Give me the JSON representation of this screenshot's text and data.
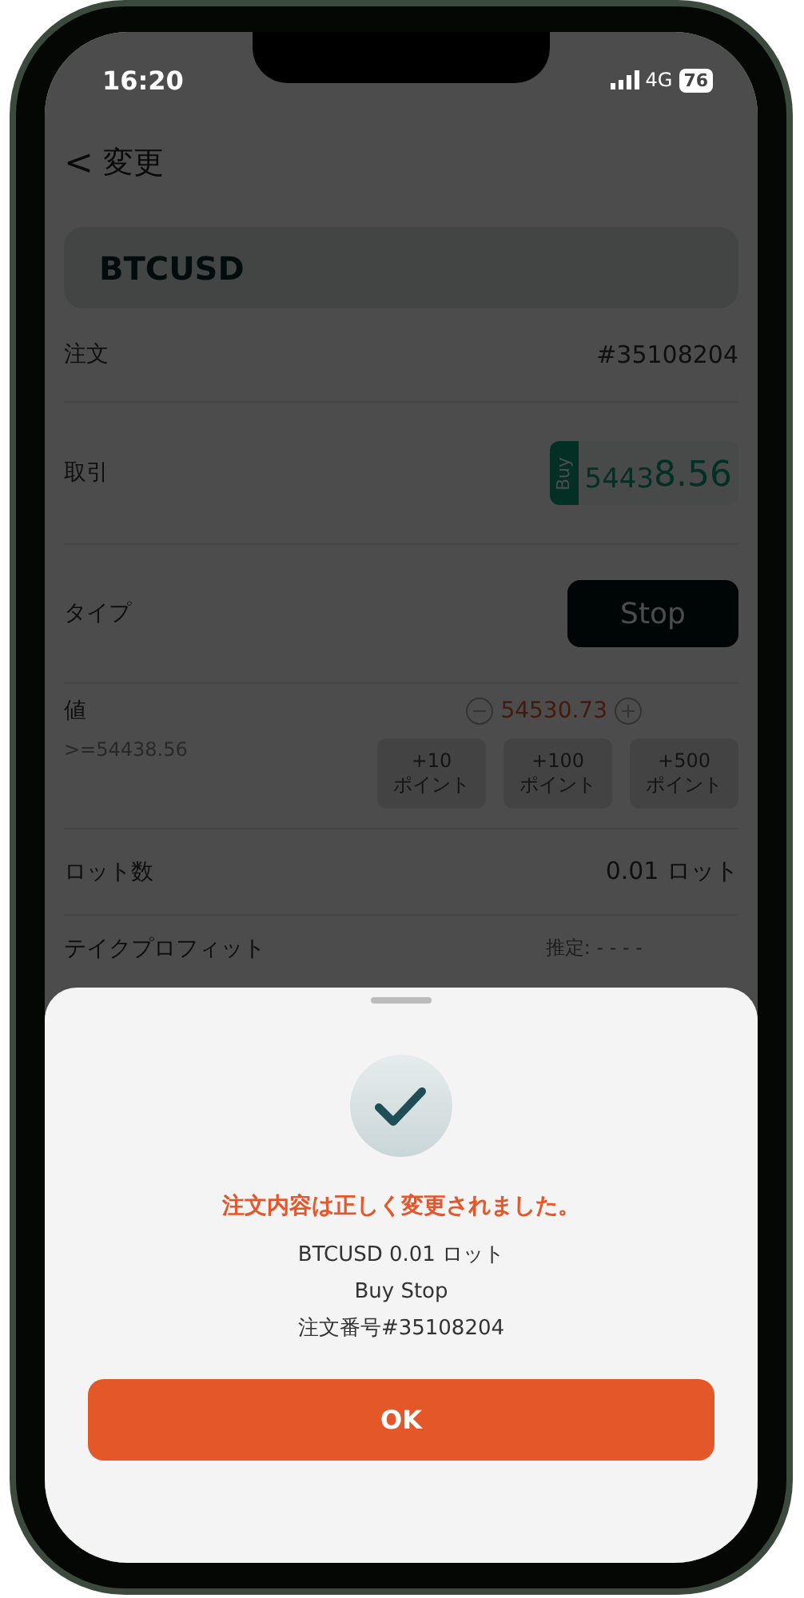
{
  "status_bar": {
    "time": "16:20",
    "network": "4G",
    "battery": "76"
  },
  "header": {
    "back": "<",
    "title": "変更"
  },
  "symbol": "BTCUSD",
  "rows": [
    {
      "kind": "text",
      "label": "注文",
      "value": "#35108204"
    },
    {
      "kind": "trade",
      "label": "取引",
      "side": "Buy",
      "price_main": "5443",
      "price_big": "8.56"
    },
    {
      "kind": "type",
      "label": "タイプ",
      "value": "Stop"
    },
    {
      "kind": "price",
      "label": "値",
      "value": "54530.73",
      "hint": ">=54438.56",
      "steps": [
        {
          "amount": "+10",
          "unit": "ポイント"
        },
        {
          "amount": "+100",
          "unit": "ポイント"
        },
        {
          "amount": "+500",
          "unit": "ポイント"
        }
      ]
    },
    {
      "kind": "text",
      "label": "ロット数",
      "value": "0.01 ロット"
    },
    {
      "kind": "estimate",
      "label": "テイクプロフィット",
      "value": "推定: - - - -"
    }
  ],
  "dialog": {
    "title": "注文内容は正しく変更されました。",
    "lines": [
      "BTCUSD 0.01 ロット",
      "Buy Stop",
      "注文番号#35108204"
    ],
    "button": "OK"
  }
}
